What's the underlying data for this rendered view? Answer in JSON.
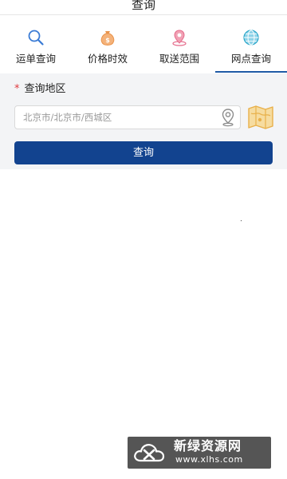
{
  "header": {
    "title": "查询"
  },
  "tabs": [
    {
      "label": "运单查询",
      "icon": "search-icon",
      "active": false
    },
    {
      "label": "价格时效",
      "icon": "money-bag-icon",
      "active": false
    },
    {
      "label": "取送范围",
      "icon": "map-pin-icon",
      "active": false
    },
    {
      "label": "网点查询",
      "icon": "globe-icon",
      "active": true
    }
  ],
  "form": {
    "required_mark": "*",
    "region_label": "查询地区",
    "region_value": "北京市/北京市/西城区",
    "location_icon": "location-pin-icon",
    "map_icon": "folded-map-icon",
    "query_button_label": "查询"
  },
  "watermark": {
    "title": "新绿资源网",
    "url": "www.xlhs.com"
  },
  "colors": {
    "primary": "#12438f",
    "required": "#e0393e",
    "panel_bg": "#f3f4f6",
    "tab_search": "#3a7bd5",
    "tab_money": "#e9934a",
    "tab_pin": "#e56a8a",
    "tab_globe": "#2aa6c9",
    "map_icon": "#e8b04a"
  }
}
